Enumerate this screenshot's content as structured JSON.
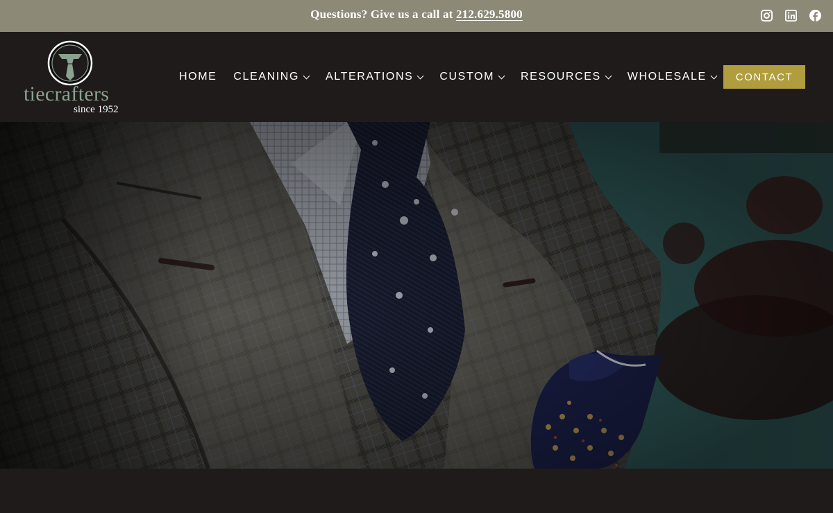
{
  "topbar": {
    "text": "Questions? Give us a call at",
    "phone": "212.629.5800",
    "social": [
      {
        "icon": "instagram-icon"
      },
      {
        "icon": "linkedin-icon"
      },
      {
        "icon": "facebook-icon"
      }
    ]
  },
  "brand": {
    "name": "tiecrafters",
    "tagline": "since 1952"
  },
  "nav": {
    "items": [
      {
        "label": "HOME",
        "dropdown": false
      },
      {
        "label": "CLEANING",
        "dropdown": true
      },
      {
        "label": "ALTERATIONS",
        "dropdown": true
      },
      {
        "label": "CUSTOM",
        "dropdown": true
      },
      {
        "label": "RESOURCES",
        "dropdown": true
      },
      {
        "label": "WHOLESALE",
        "dropdown": true
      }
    ],
    "contact_label": "CONTACT"
  },
  "colors": {
    "topbar_bg": "#8c8977",
    "header_bg": "#1f1b1b",
    "accent_gold": "#b09d3d",
    "logo_green": "#8aa28e"
  }
}
